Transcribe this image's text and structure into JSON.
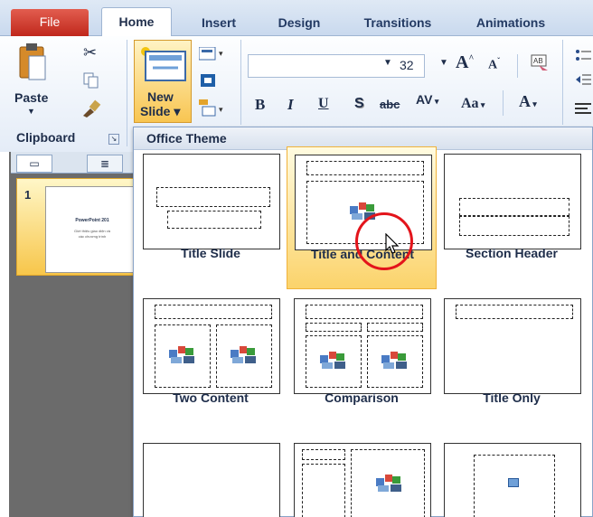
{
  "tabs": [
    "File",
    "Home",
    "Insert",
    "Design",
    "Transitions",
    "Animations"
  ],
  "clipboard": {
    "paste_label": "Paste",
    "group_label": "Clipboard"
  },
  "slides_group": {
    "new_slide_line1": "New",
    "new_slide_line2": "Slide ▾"
  },
  "font": {
    "font_name": "",
    "font_size": "32"
  },
  "format_buttons": {
    "bold": "B",
    "italic": "I",
    "underline": "U",
    "shadow": "S",
    "strike": "abc",
    "spacing": "AV",
    "case": "Aa",
    "color": "A"
  },
  "slide_panel": {
    "slide_number": "1",
    "thumb_title": "PowerPoint 201",
    "thumb_line1": "Giới thiệu giao diện và",
    "thumb_line2": "các chương trình"
  },
  "gallery": {
    "header": "Office Theme",
    "layouts": [
      {
        "label": "Title Slide"
      },
      {
        "label": "Title and Content"
      },
      {
        "label": "Section Header"
      },
      {
        "label": "Two Content"
      },
      {
        "label": "Comparison"
      },
      {
        "label": "Title Only"
      },
      {
        "label": ""
      },
      {
        "label": ""
      },
      {
        "label": ""
      }
    ]
  },
  "colors": {
    "file_tab": "#c0281c",
    "selection": "#fbd36b",
    "cursor_ring": "#e3141b"
  }
}
